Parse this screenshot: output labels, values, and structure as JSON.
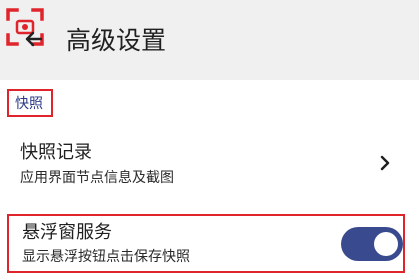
{
  "header": {
    "title": "高级设置",
    "capture_icon": "screen-capture-icon",
    "back_icon": "back-arrow-icon"
  },
  "section": {
    "title": "快照"
  },
  "items": [
    {
      "title": "快照记录",
      "subtitle": "应用界面节点信息及截图",
      "icon": "chevron-right-icon"
    },
    {
      "title": "悬浮窗服务",
      "subtitle": "显示悬浮按钮点击保存快照",
      "toggle_on": true
    }
  ],
  "colors": {
    "accent": "#3a4a8e",
    "highlight": "#e0242c",
    "appbar_bg": "#f0f0f0",
    "section_text": "#2b3a86"
  }
}
